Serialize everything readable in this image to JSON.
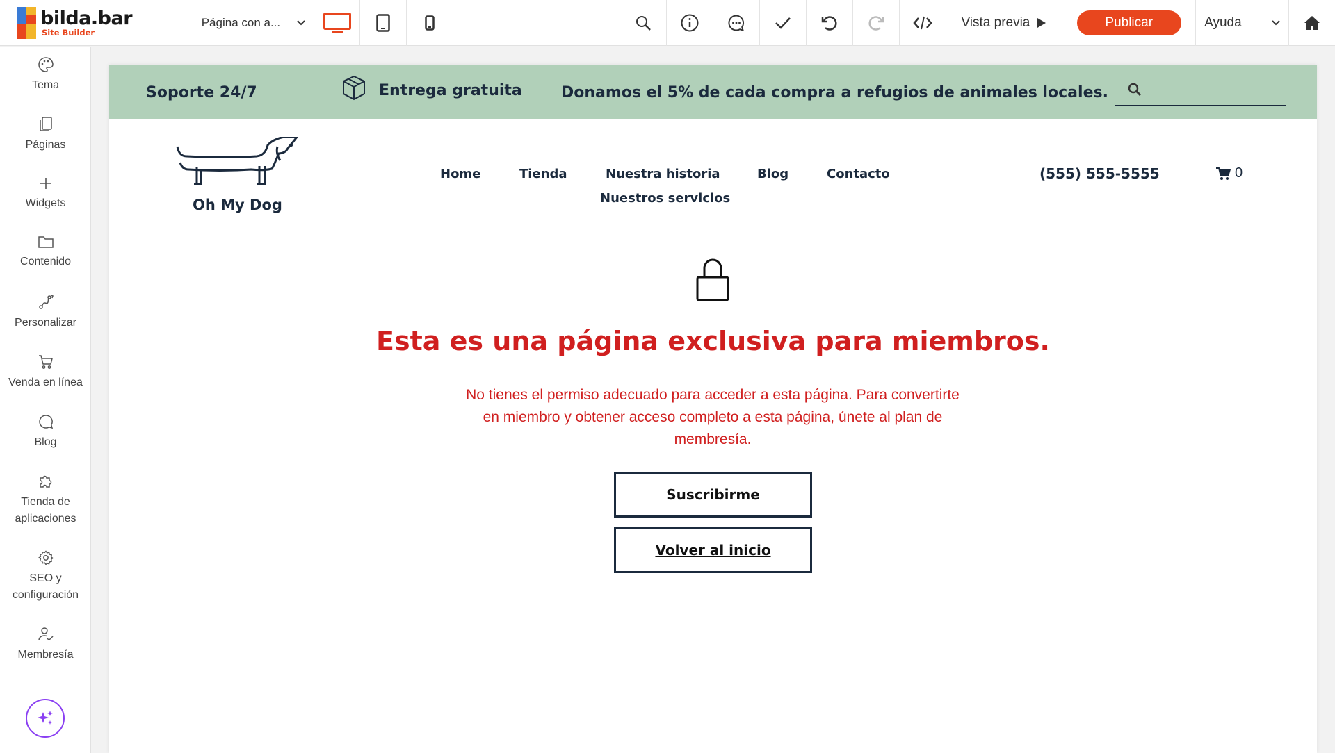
{
  "app": {
    "logo_name": "bilda.bar",
    "logo_sub": "Site Builder"
  },
  "toolbar": {
    "page_select": "Página con a...",
    "preview_label": "Vista previa",
    "publish_label": "Publicar",
    "help_label": "Ayuda",
    "accent": "#e8461e"
  },
  "sidebar": {
    "items": [
      {
        "label": "Tema",
        "icon": "palette-icon"
      },
      {
        "label": "Páginas",
        "icon": "pages-icon"
      },
      {
        "label": "Widgets",
        "icon": "plus-icon"
      },
      {
        "label": "Contenido",
        "icon": "folder-icon"
      },
      {
        "label": "Personalizar",
        "icon": "customize-icon"
      },
      {
        "label": "Venda en línea",
        "icon": "cart-icon"
      },
      {
        "label": "Blog",
        "icon": "chat-bubble-icon"
      },
      {
        "label": "Tienda de aplicaciones",
        "icon": "puzzle-icon"
      },
      {
        "label": "SEO y configuración",
        "icon": "gear-icon"
      },
      {
        "label": "Membresía",
        "icon": "member-icon"
      }
    ]
  },
  "site": {
    "promo": {
      "support": "Soporte 24/7",
      "delivery": "Entrega gratuita",
      "donation": "Donamos el 5% de cada compra a refugios de animales locales.",
      "bg_color": "#b1d0b9"
    },
    "brand": "Oh My Dog",
    "nav": [
      "Home",
      "Tienda",
      "Nuestra historia",
      "Blog",
      "Contacto",
      "Nuestros servicios"
    ],
    "phone": "(555) 555-5555",
    "cart_count": "0",
    "members": {
      "title": "Esta es una página exclusiva para miembros.",
      "text": "No tienes el permiso adecuado para acceder a esta página. Para convertirte en miembro y obtener acceso completo a esta página, únete al plan de membresía.",
      "subscribe": "Suscribirme",
      "back_home": "Volver al inicio",
      "accent": "#d01f1f"
    }
  }
}
